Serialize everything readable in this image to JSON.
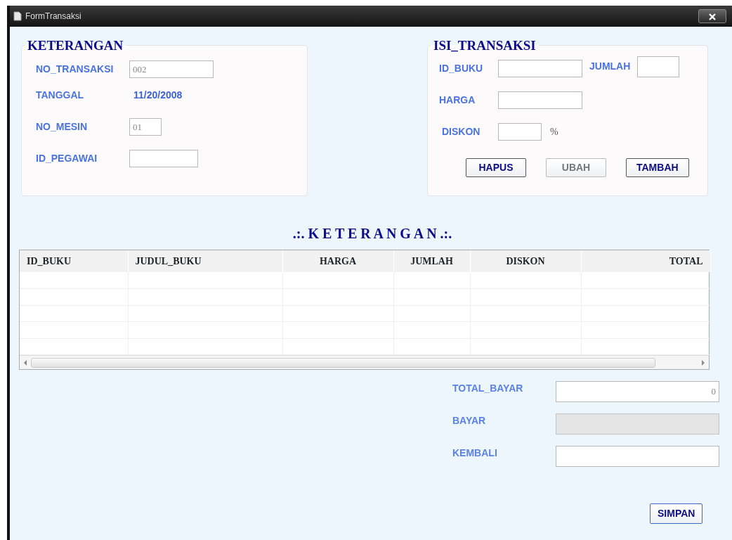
{
  "window": {
    "title": "FormTransaksi"
  },
  "keterangan": {
    "title": "KETERANGAN",
    "fields": [
      {
        "label": "NO_TRANSAKSI",
        "kind": "input",
        "value": "002"
      },
      {
        "label": "TANGGAL",
        "kind": "text",
        "value": "11/20/2008"
      },
      {
        "label": "NO_MESIN",
        "kind": "input",
        "value": "01"
      },
      {
        "label": "ID_PEGAWAI",
        "kind": "input"
      }
    ]
  },
  "isi_transaksi": {
    "title": "ISI_TRANSAKSI",
    "fields": [
      {
        "label": "ID_BUKU"
      },
      {
        "label": "JUMLAH"
      },
      {
        "label": "HARGA"
      },
      {
        "label": "DISKON",
        "suffix": "%"
      }
    ],
    "buttons": [
      {
        "label": "HAPUS",
        "disabled": false
      },
      {
        "label": "UBAH",
        "disabled": true
      },
      {
        "label": "TAMBAH",
        "disabled": false
      }
    ]
  },
  "table": {
    "title": ".:. K E T E R A N G A N .:.",
    "columns": [
      "ID_BUKU",
      "JUDUL_BUKU",
      "HARGA",
      "JUMLAH",
      "DISKON",
      "TOTAL"
    ]
  },
  "summary": [
    {
      "label": "TOTAL_BAYAR",
      "value": "0",
      "disabled": false
    },
    {
      "label": "BAYAR",
      "disabled": true
    },
    {
      "label": "KEMBALI",
      "disabled": false
    }
  ],
  "save_button": {
    "label": "SIMPAN"
  }
}
